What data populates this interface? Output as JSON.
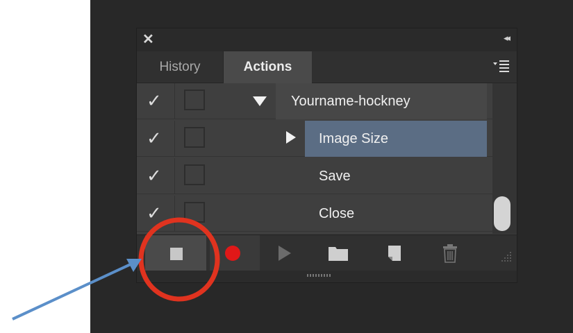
{
  "panel": {
    "close_glyph": "✕",
    "collapse_glyph": "◂◂",
    "tabs": [
      {
        "label": "History"
      },
      {
        "label": "Actions"
      }
    ]
  },
  "actions": {
    "rows": [
      {
        "label": "Yourname-hockney",
        "type": "set",
        "expanded": true,
        "checked": true
      },
      {
        "label": "Image Size",
        "type": "action",
        "selected": true,
        "checked": true
      },
      {
        "label": "Save",
        "type": "action",
        "checked": true
      },
      {
        "label": "Close",
        "type": "action",
        "checked": true
      }
    ],
    "check_glyph": "✓"
  },
  "toolbar": {
    "buttons": [
      "stop-recording",
      "begin-recording",
      "play-selection",
      "create-new-set",
      "create-new-action",
      "delete"
    ]
  },
  "colors": {
    "selection": "#5b6d84",
    "record": "#e01818",
    "annotation_circle": "#e0331f",
    "annotation_arrow": "#5b8fc9"
  }
}
